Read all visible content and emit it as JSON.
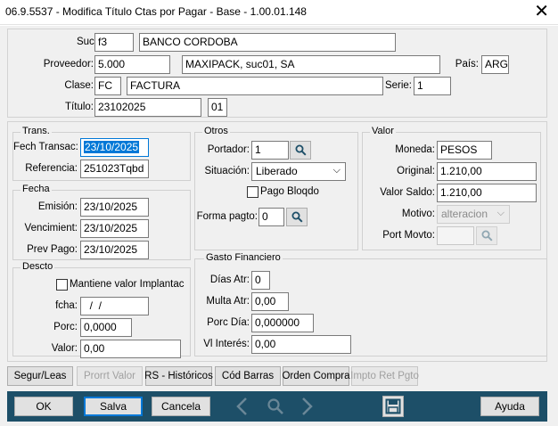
{
  "window": {
    "title": "06.9.5537 - Modifica Título Ctas por Pagar - Base - 1.00.01.148"
  },
  "header": {
    "suc_label": "Suc:",
    "suc_code": "f3",
    "suc_name": "BANCO CORDOBA",
    "proveedor_label": "Proveedor:",
    "proveedor_code": "5.000",
    "proveedor_name": "MAXIPACK, suc01, SA",
    "pais_label": "País:",
    "pais_value": "ARG",
    "clase_label": "Clase:",
    "clase_code": "FC",
    "clase_name": "FACTURA",
    "serie_label": "Serie:",
    "serie_value": "1",
    "titulo_label": "Título:",
    "titulo_value": "23102025",
    "titulo_suffix": "01"
  },
  "trans": {
    "legend": "Trans.",
    "fech_transac_label": "Fech Transac:",
    "fech_transac_value": "23/10/2025",
    "referencia_label": "Referencia:",
    "referencia_value": "251023Tqbd"
  },
  "fecha": {
    "legend": "Fecha",
    "emision_label": "Emisión:",
    "emision_value": "23/10/2025",
    "vencimiento_label": "Vencimient:",
    "vencimiento_value": "23/10/2025",
    "prev_pago_label": "Prev Pago:",
    "prev_pago_value": "23/10/2025"
  },
  "descto": {
    "legend": "Descto",
    "mantiene_label": "Mantiene valor Implantac",
    "fcha_label": "fcha:",
    "fcha_value": "  /  /",
    "porc_label": "Porc:",
    "porc_value": "0,0000",
    "valor_label": "Valor:",
    "valor_value": "0,00"
  },
  "otros": {
    "legend": "Otros",
    "portador_label": "Portador:",
    "portador_value": "1",
    "situacion_label": "Situación:",
    "situacion_value": "Liberado",
    "pago_bloqdo_label": "Pago Bloqdo",
    "forma_pagto_label": "Forma pagto:",
    "forma_pagto_value": "0"
  },
  "valor": {
    "legend": "Valor",
    "moneda_label": "Moneda:",
    "moneda_value": "PESOS",
    "original_label": "Original:",
    "original_value": "1.210,00",
    "saldo_label": "Valor Saldo:",
    "saldo_value": "1.210,00",
    "motivo_label": "Motivo:",
    "motivo_value": "alteracion",
    "port_movto_label": "Port Movto:",
    "port_movto_value": ""
  },
  "gasto": {
    "legend": "Gasto Financiero",
    "dias_atr_label": "Días Atr:",
    "dias_atr_value": "0",
    "multa_atr_label": "Multa Atr:",
    "multa_atr_value": "0,00",
    "porc_dia_label": "Porc Día:",
    "porc_dia_value": "0,000000",
    "vl_interes_label": "Vl Interés:",
    "vl_interes_value": "0,00"
  },
  "tabs": [
    "Segur/Leas",
    "Prorrt Valor",
    "RS - Históricos",
    "Cód Barras",
    "Orden Compra",
    "Impto Ret Pgto"
  ],
  "footer": {
    "ok": "OK",
    "salva": "Salva",
    "cancela": "Cancela",
    "ayuda": "Ayuda"
  },
  "colors": {
    "footer_bg": "#1d4f68",
    "selection": "#0078d7"
  },
  "icons": [
    "search-icon",
    "chevron-down-icon",
    "close-icon",
    "arrow-left-icon",
    "arrow-right-icon",
    "save-icon"
  ]
}
